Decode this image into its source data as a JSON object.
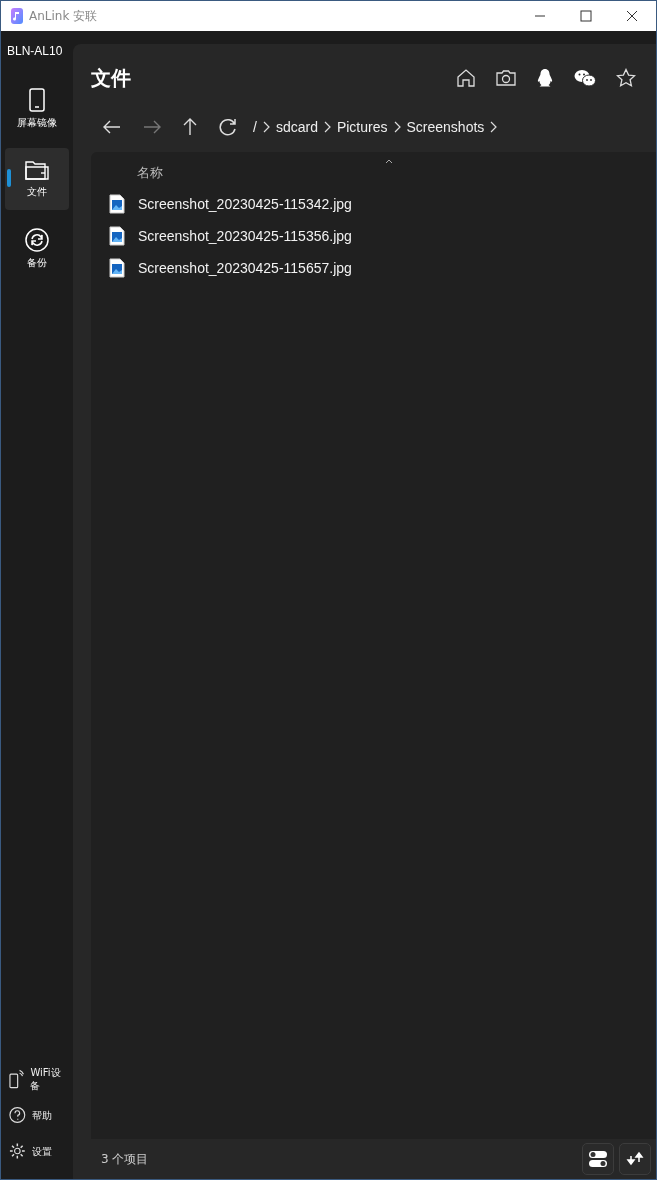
{
  "window": {
    "title": "AnLink 安联"
  },
  "device": "BLN-AL10",
  "nav": [
    {
      "label": "屏幕镜像",
      "selected": false
    },
    {
      "label": "文件",
      "selected": true
    },
    {
      "label": "备份",
      "selected": false
    }
  ],
  "nav_bottom": [
    {
      "label": "WiFi设备"
    },
    {
      "label": "帮助"
    },
    {
      "label": "设置"
    }
  ],
  "page_title": "文件",
  "nav_buttons": [
    {
      "disabled": false
    },
    {
      "disabled": true
    },
    {
      "disabled": false
    },
    {
      "disabled": false
    }
  ],
  "breadcrumb": [
    "/",
    "sdcard",
    "Pictures",
    "Screenshots"
  ],
  "column": "名称",
  "files": [
    {
      "name": "Screenshot_20230425-115342.jpg"
    },
    {
      "name": "Screenshot_20230425-115356.jpg"
    },
    {
      "name": "Screenshot_20230425-115657.jpg"
    }
  ],
  "status": "3 个项目"
}
